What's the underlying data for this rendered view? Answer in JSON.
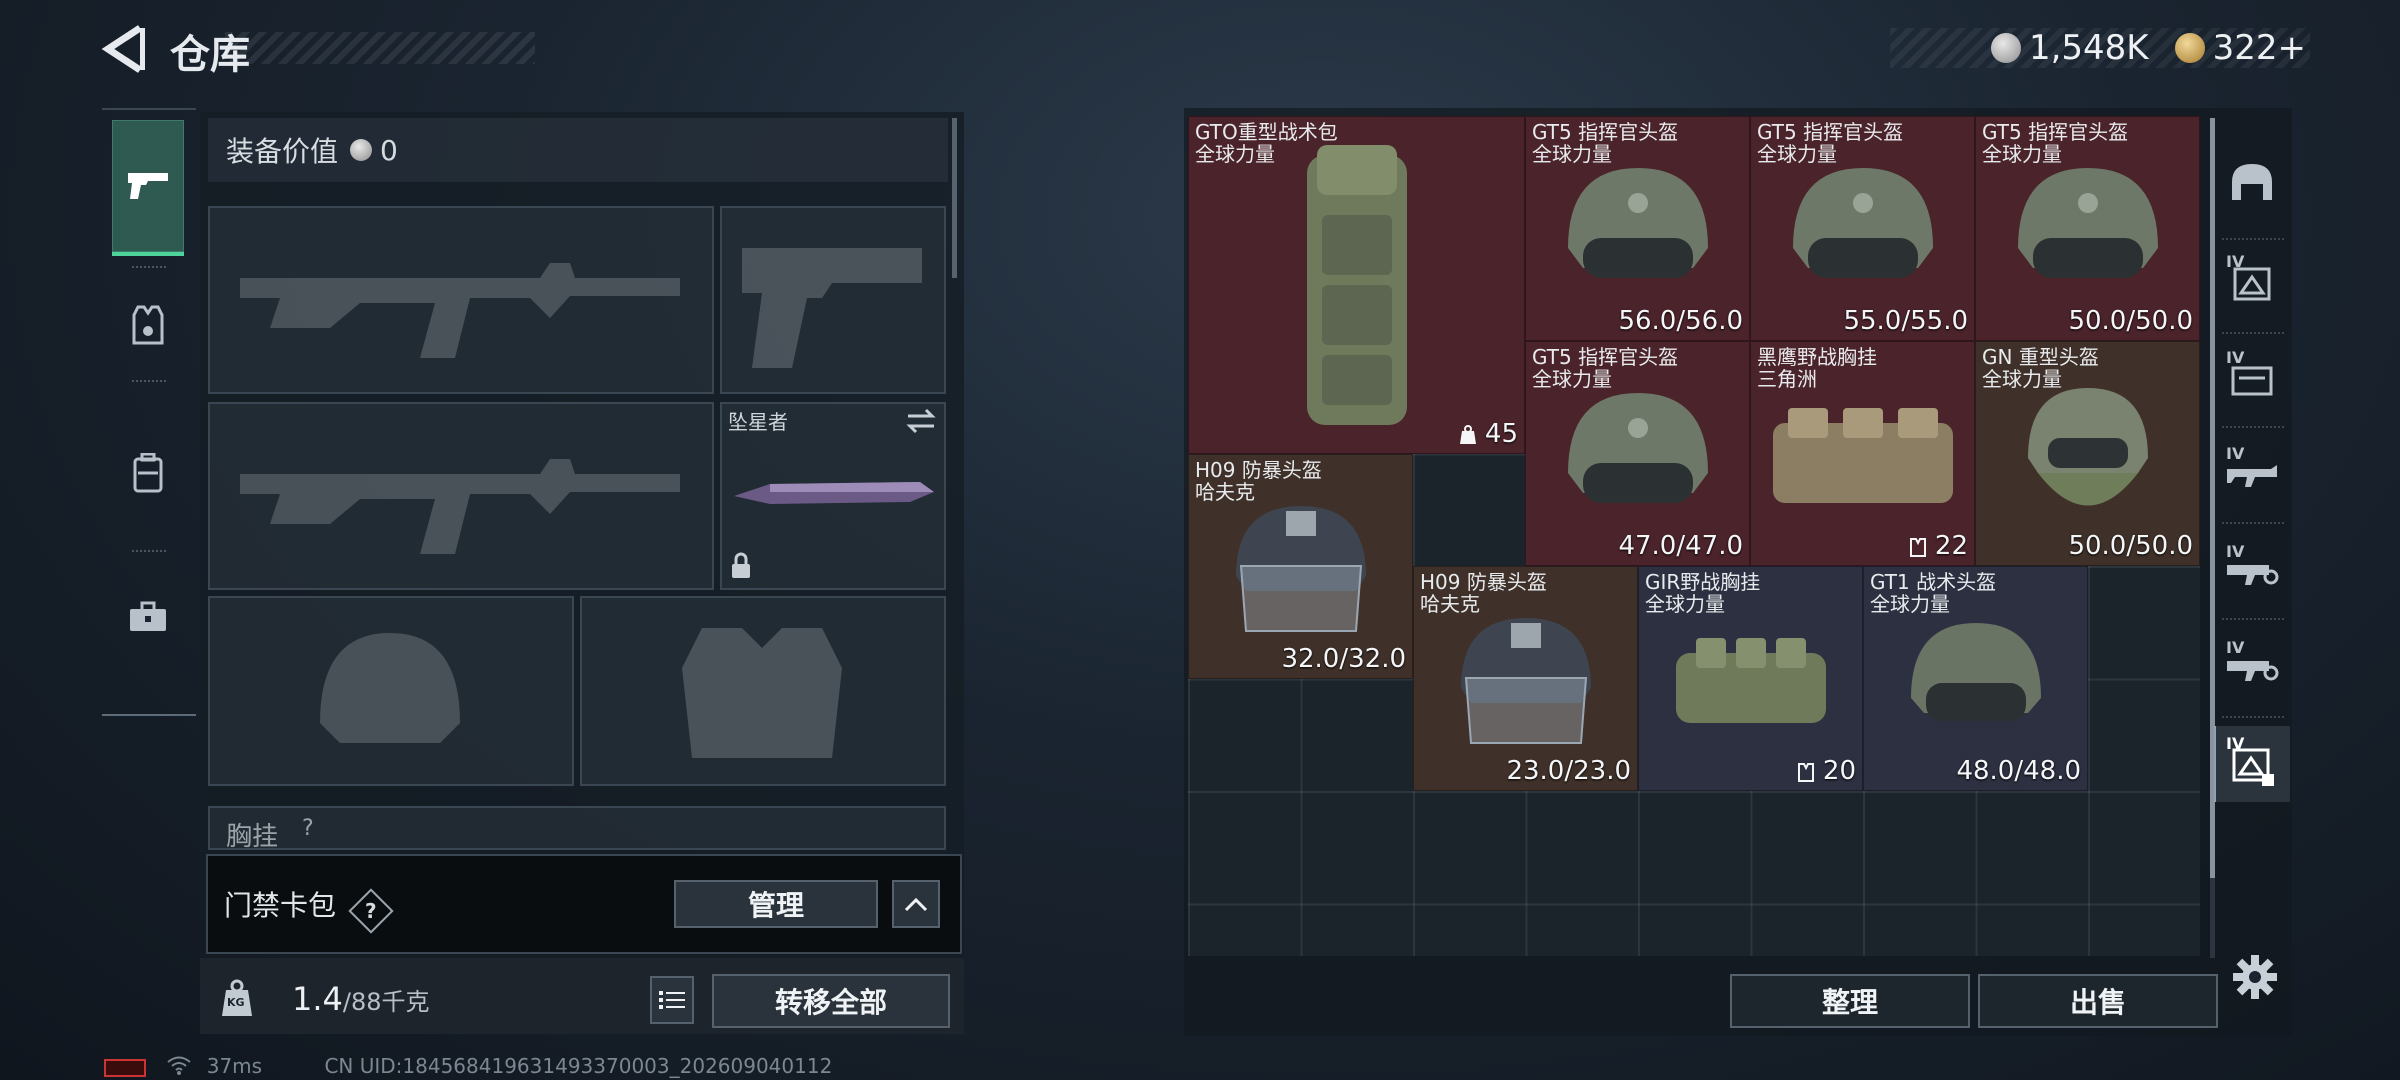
{
  "header": {
    "title": "仓库",
    "currencies": [
      {
        "icon": "silver-coin-icon",
        "value": "1,548K"
      },
      {
        "icon": "gold-coin-icon",
        "value": "322+"
      }
    ]
  },
  "sidebar_tabs": [
    {
      "icon": "pistol-icon",
      "active": true
    },
    {
      "icon": "armor-vest-icon",
      "active": false
    },
    {
      "icon": "backpack-icon",
      "active": false
    },
    {
      "icon": "toolbox-icon",
      "active": false
    }
  ],
  "loadout": {
    "value_label": "装备价值",
    "value": "0",
    "melee_slot_title": "坠星者",
    "chest_rig_label": "胸挂",
    "chest_rig_hint": "?"
  },
  "card_pack": {
    "label": "门禁卡包",
    "help": "?",
    "manage_button": "管理"
  },
  "weight": {
    "current": "1.4",
    "max": "/88千克",
    "weight_icon_text": "KG"
  },
  "transfer_all_button": "转移全部",
  "status": {
    "ping": "37ms",
    "uid": "CN UID:184568419631493370003_202609040112"
  },
  "inventory_items": [
    {
      "name": "GTO重型战术包",
      "sub": "全球力量",
      "value": "45",
      "color": "red"
    },
    {
      "name": "GT5 指挥官头盔",
      "sub": "全球力量",
      "value": "56.0/56.0",
      "color": "red"
    },
    {
      "name": "GT5 指挥官头盔",
      "sub": "全球力量",
      "value": "55.0/55.0",
      "color": "red"
    },
    {
      "name": "GT5 指挥官头盔",
      "sub": "全球力量",
      "value": "50.0/50.0",
      "color": "red"
    },
    {
      "name": "GT5 指挥官头盔",
      "sub": "全球力量",
      "value": "47.0/47.0",
      "color": "red"
    },
    {
      "name": "黑鹰野战胸挂",
      "sub": "三角洲",
      "value": "22",
      "color": "red"
    },
    {
      "name": "GN 重型头盔",
      "sub": "全球力量",
      "value": "50.0/50.0",
      "color": "brown"
    },
    {
      "name": "H09 防暴头盔",
      "sub": "哈夫克",
      "value": "32.0/32.0",
      "color": "brown"
    },
    {
      "name": "H09 防暴头盔",
      "sub": "哈夫克",
      "value": "23.0/23.0",
      "color": "brown"
    },
    {
      "name": "GIR野战胸挂",
      "sub": "全球力量",
      "value": "20",
      "color": "blue"
    },
    {
      "name": "GT1 战术头盔",
      "sub": "全球力量",
      "value": "48.0/48.0",
      "color": "blue"
    }
  ],
  "side_filters": [
    {
      "icon": "helmet-icon",
      "tier": ""
    },
    {
      "icon": "armor-filter-icon",
      "tier": "IV"
    },
    {
      "icon": "rig-filter-icon",
      "tier": "IV"
    },
    {
      "icon": "rifle-filter-icon",
      "tier": "IV"
    },
    {
      "icon": "smg-filter-icon",
      "tier": "IV"
    },
    {
      "icon": "pistol-filter-icon",
      "tier": "IV"
    },
    {
      "icon": "locked-container-icon",
      "tier": "IV"
    }
  ],
  "actions": {
    "sort_button": "整理",
    "sell_button": "出售"
  }
}
